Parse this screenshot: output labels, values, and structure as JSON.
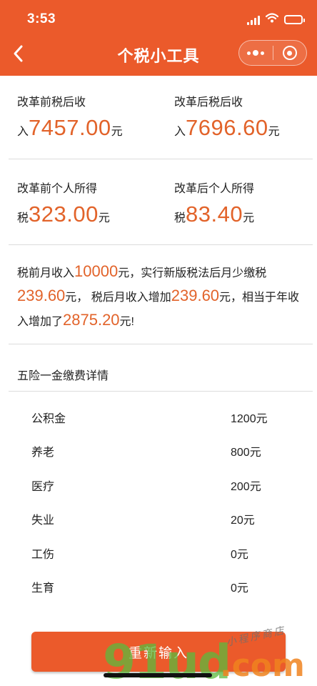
{
  "status_bar": {
    "time": "3:53"
  },
  "nav": {
    "title": "个税小工具"
  },
  "before_income": {
    "label": "改革前税后收",
    "prefix": "入",
    "value": "7457.00",
    "unit": "元"
  },
  "after_income": {
    "label": "改革后税后收",
    "prefix": "入",
    "value": "7696.60",
    "unit": "元"
  },
  "before_tax": {
    "label": "改革前个人所得",
    "prefix": "税",
    "value": "323.00",
    "unit": "元"
  },
  "after_tax": {
    "label": "改革后个人所得",
    "prefix": "税",
    "value": "83.40",
    "unit": "元"
  },
  "summary": {
    "t1": "税前月收入",
    "v1": "10000",
    "t2": "元，实行新版税法后月少缴税",
    "v2": "239.60",
    "t3": "元， 税后月收入增加",
    "v3": "239.60",
    "t4": "元，相当于年收入增加了",
    "v4": "2875.20",
    "t5": "元!"
  },
  "insurance": {
    "title": "五险一金缴费详情",
    "items": [
      {
        "name": "公积金",
        "amount": "1200元"
      },
      {
        "name": "养老",
        "amount": "800元"
      },
      {
        "name": "医疗",
        "amount": "200元"
      },
      {
        "name": "失业",
        "amount": "20元"
      },
      {
        "name": "工伤",
        "amount": "0元"
      },
      {
        "name": "生育",
        "amount": "0元"
      }
    ]
  },
  "reset_label": "重新输入",
  "watermark": {
    "brand": "91ud",
    "domain": ".com",
    "script": "小程序商店"
  },
  "colors": {
    "brand": "#eb5a2b",
    "highlight": "#e2632a"
  },
  "icons": [
    "back-icon",
    "signal-icon",
    "wifi-icon",
    "battery-icon",
    "more-icon",
    "close-miniprogram-icon"
  ]
}
